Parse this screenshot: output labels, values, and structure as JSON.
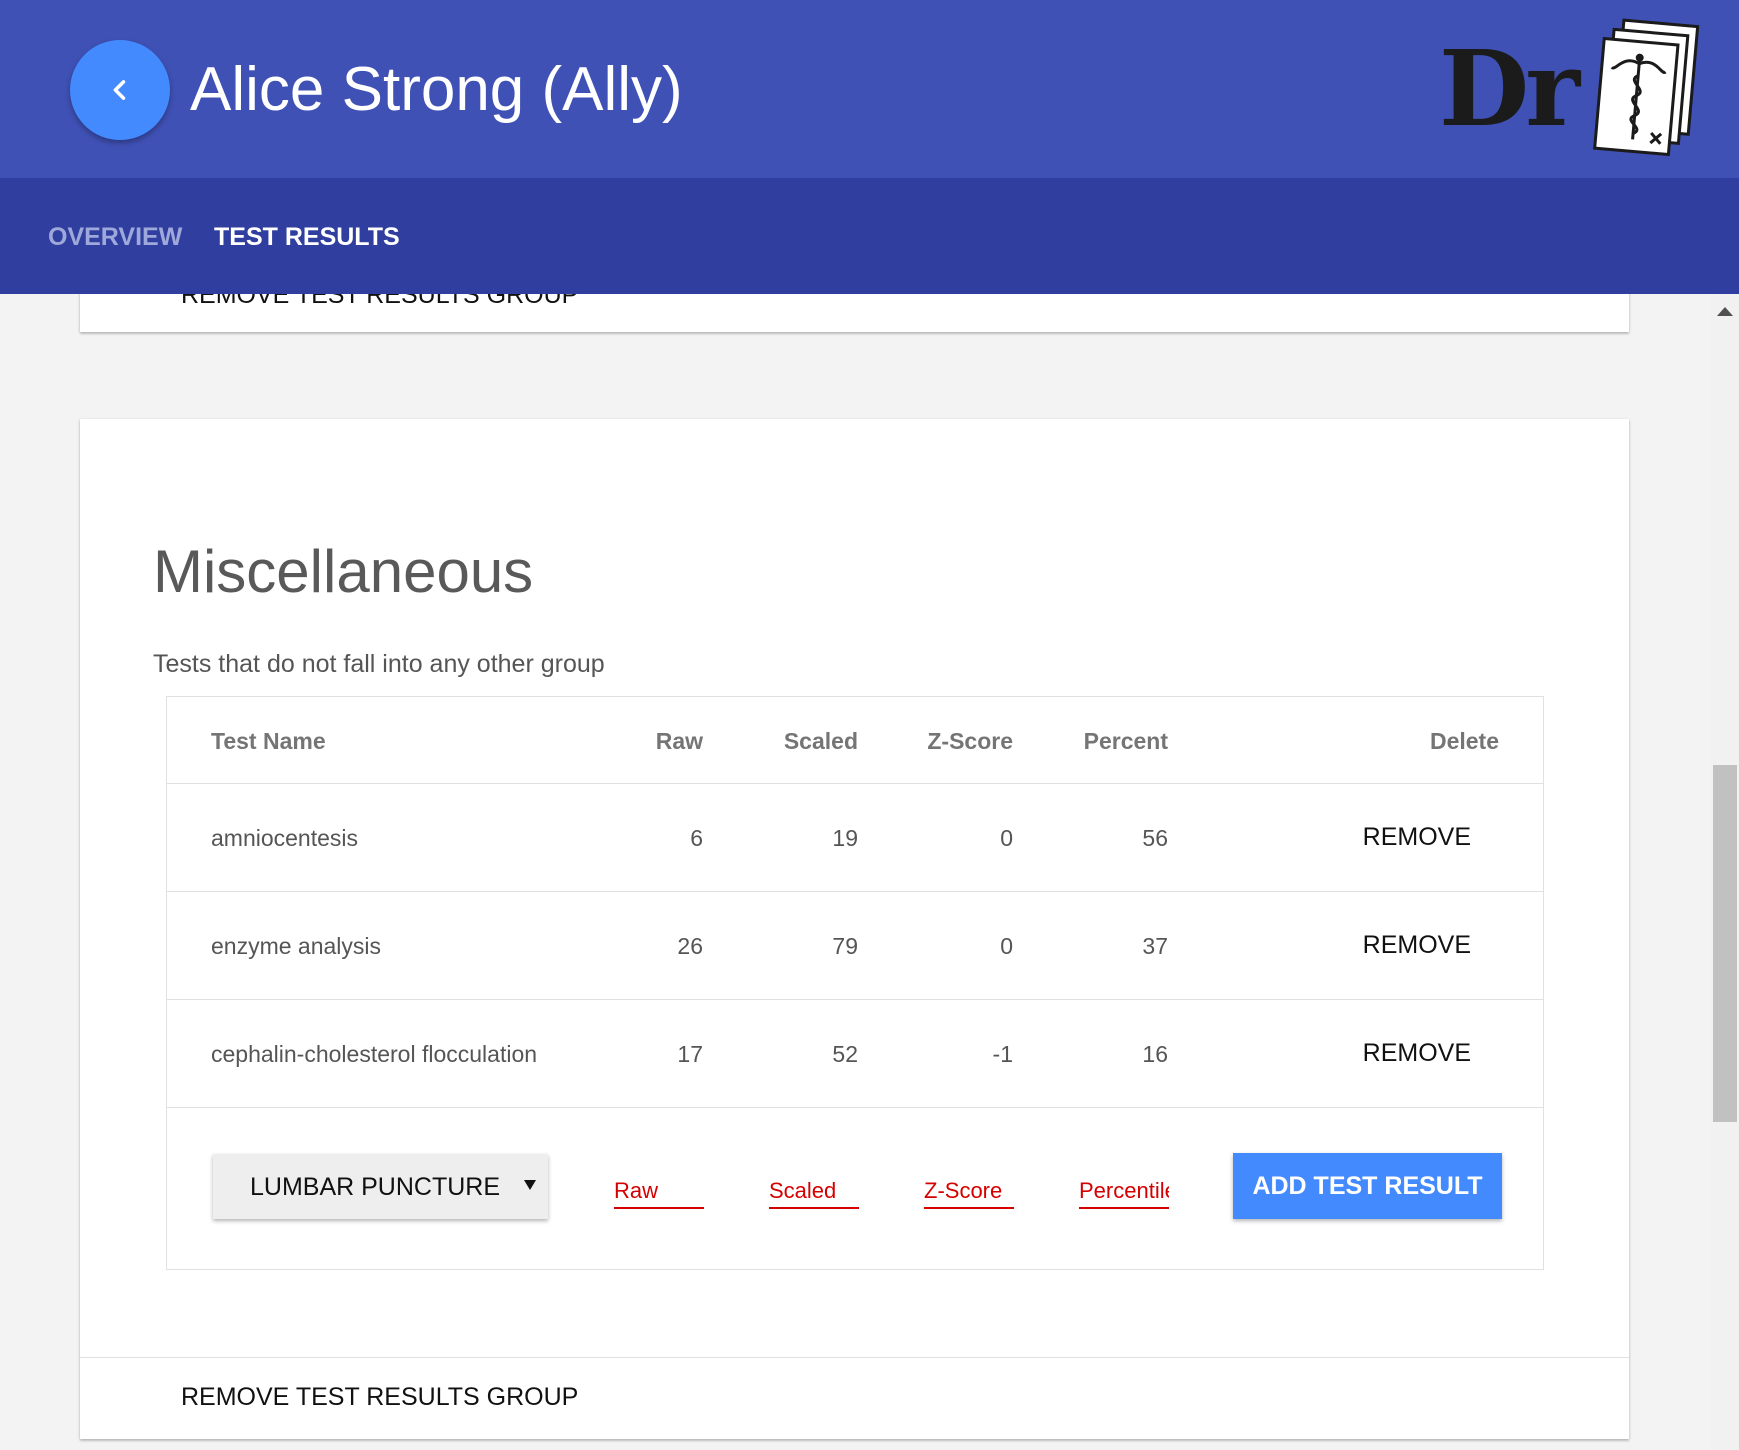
{
  "header": {
    "title": "Alice Strong (Ally)",
    "logo_text": "Dr",
    "back_icon": "chevron-left-icon",
    "brand_color": "#3f51b5",
    "tab_bar_color": "#303f9f",
    "accent_color": "#448aff"
  },
  "tabs": [
    {
      "label": "OVERVIEW",
      "active": false
    },
    {
      "label": "TEST RESULTS",
      "active": true
    }
  ],
  "previous_group": {
    "remove_label": "REMOVE TEST RESULTS GROUP"
  },
  "group": {
    "title": "Miscellaneous",
    "description": "Tests that do not fall into any other group",
    "columns": [
      "Test Name",
      "Raw",
      "Scaled",
      "Z-Score",
      "Percent",
      "Delete"
    ],
    "rows": [
      {
        "name": "amniocentesis",
        "raw": "6",
        "scaled": "19",
        "z": "0",
        "percent": "56",
        "action": "REMOVE"
      },
      {
        "name": "enzyme analysis",
        "raw": "26",
        "scaled": "79",
        "z": "0",
        "percent": "37",
        "action": "REMOVE"
      },
      {
        "name": "cephalin-cholesterol flocculation",
        "raw": "17",
        "scaled": "52",
        "z": "-1",
        "percent": "16",
        "action": "REMOVE"
      }
    ],
    "add_form": {
      "selected_test": "LUMBAR PUNCTURE",
      "raw_placeholder": "Raw",
      "scaled_placeholder": "Scaled",
      "z_placeholder": "Z-Score",
      "percentile_placeholder": "Percentile",
      "add_label": "ADD TEST RESULT",
      "error_color": "#d50000"
    },
    "remove_label": "REMOVE TEST RESULTS GROUP"
  }
}
